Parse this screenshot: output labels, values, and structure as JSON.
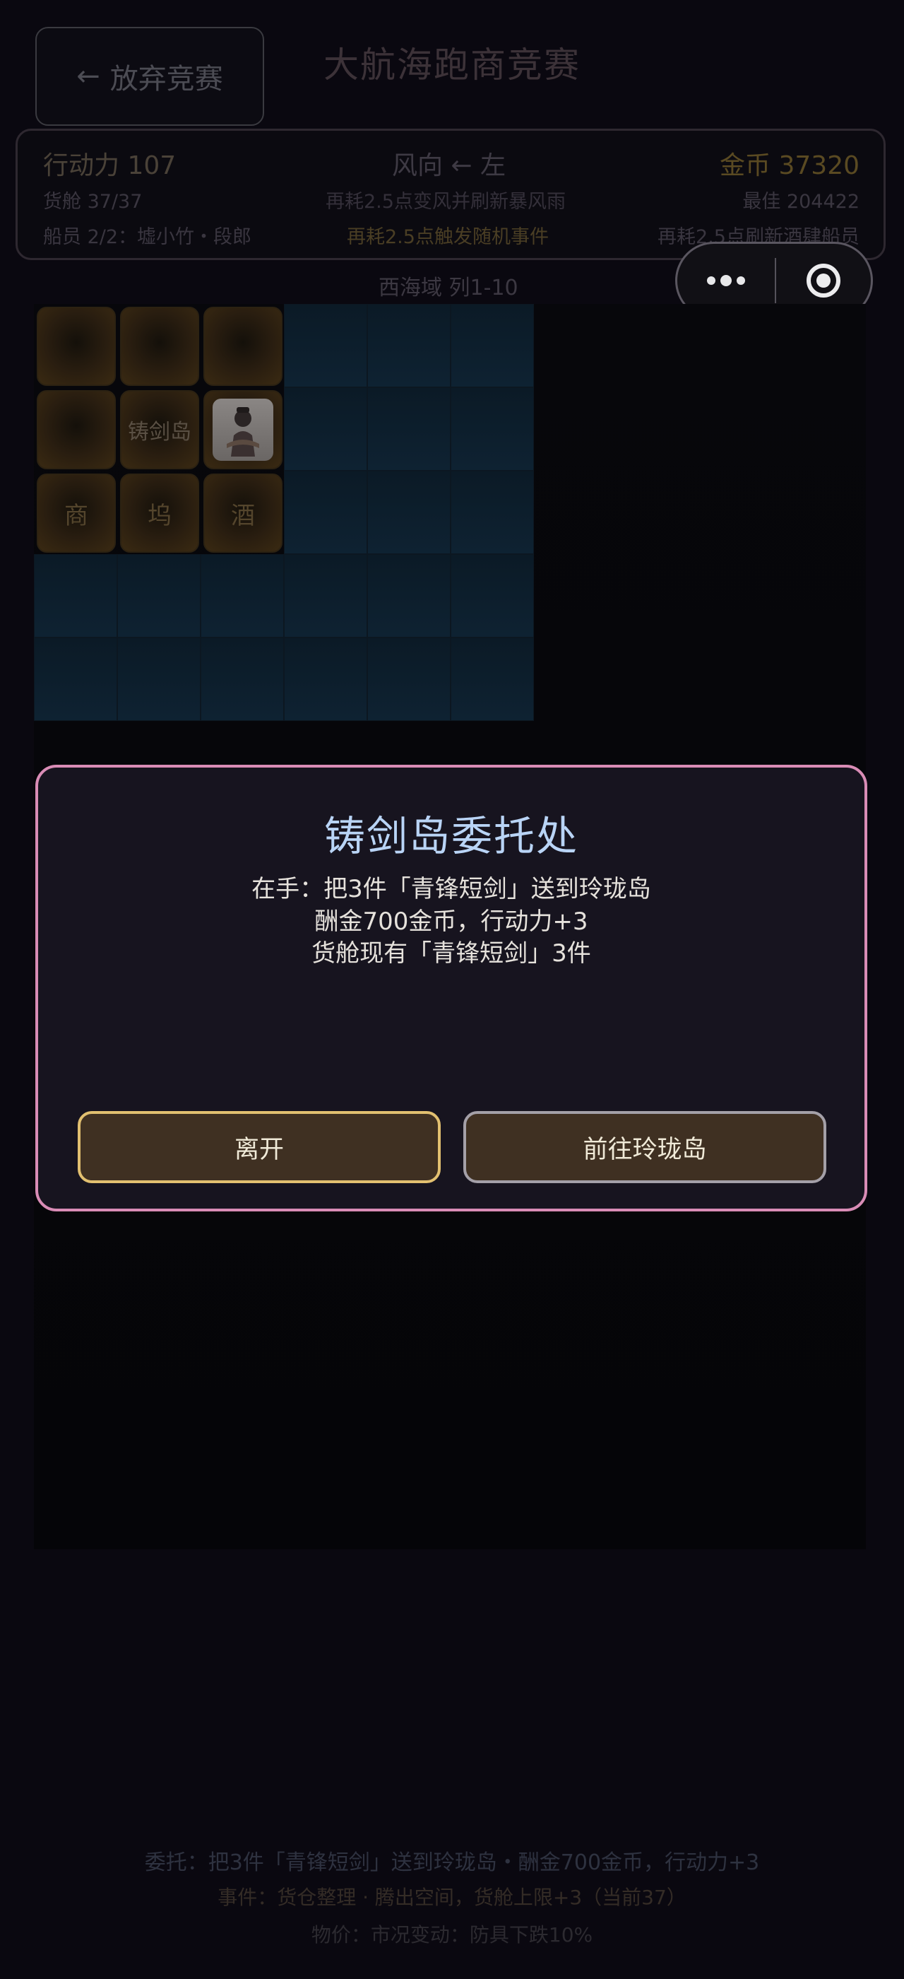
{
  "header": {
    "back_arrow": "←",
    "quit_label": "放弃竞赛",
    "title": "大航海跑商竞赛"
  },
  "status": {
    "action_points": "行动力 107",
    "wind": "风向 ← 左",
    "gold": "金币 37320",
    "cargo": "货舱 37/37",
    "rewind_hint": "再耗2.5点变风并刷新暴风雨",
    "best": "最佳 204422",
    "crew": "船员 2/2：墟小竹・段郎",
    "event_hint": "再耗2.5点触发随机事件",
    "tavern_hint": "再耗2.5点刷新酒肆船员"
  },
  "capsule": {
    "more_icon": "more-dots-icon",
    "close_icon": "target-close-icon"
  },
  "map": {
    "region": "西海域 列1-10",
    "tiles": {
      "island_name": "铸剑岛",
      "shop": "商",
      "dock": "坞",
      "tavern": "酒"
    }
  },
  "modal": {
    "title": "铸剑岛委托处",
    "line1": "在手：把3件「青锋短剑」送到玲珑岛",
    "line2": "酬金700金币，行动力+3",
    "line3": "货舱现有「青锋短剑」3件",
    "leave_label": "离开",
    "goto_label": "前往玲珑岛"
  },
  "footer": {
    "commission": "委托：把3件「青锋短剑」送到玲珑岛・酬金700金币，行动力+3",
    "event": "事件：货仓整理 · 腾出空间，货舱上限+3（当前37）",
    "price": "物价：市况变动：防具下跌10%"
  },
  "colors": {
    "modal_border": "#d98cb6",
    "modal_title": "#b9d4f6",
    "leave_border": "#e2c070",
    "goto_border": "#a4a0a8",
    "button_fill": "#3f3022"
  }
}
